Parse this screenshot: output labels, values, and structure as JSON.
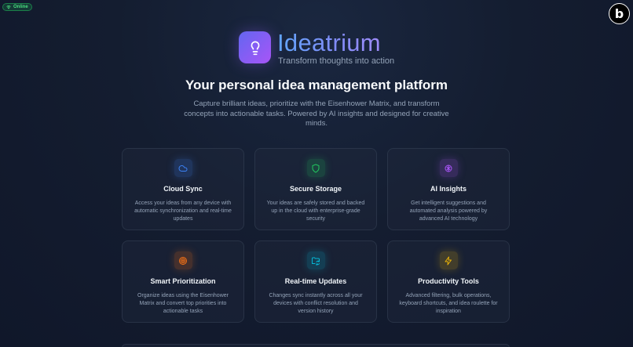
{
  "status": {
    "label": "Online",
    "icon": "wifi-icon",
    "color": "#4ade80"
  },
  "corner_badge": {
    "letter": "b"
  },
  "brand": {
    "title": "Ideatrium",
    "subtitle": "Transform thoughts into action",
    "icon": "lightbulb-icon"
  },
  "hero": {
    "headline": "Your personal idea management platform",
    "description": "Capture brilliant ideas, prioritize with the Eisenhower Matrix, and transform concepts into actionable tasks. Powered by AI insights and designed for creative minds."
  },
  "features": [
    {
      "icon": "cloud-icon",
      "accent": "#3b82f6",
      "title": "Cloud Sync",
      "description": "Access your ideas from any device with automatic synchronization and real-time updates"
    },
    {
      "icon": "shield-icon",
      "accent": "#22c55e",
      "title": "Secure Storage",
      "description": "Your ideas are safely stored and backed up in the cloud with enterprise-grade security"
    },
    {
      "icon": "brain-icon",
      "accent": "#a855f7",
      "title": "AI Insights",
      "description": "Get intelligent suggestions and automated analysis powered by advanced AI technology"
    },
    {
      "icon": "target-icon",
      "accent": "#f97316",
      "title": "Smart Prioritization",
      "description": "Organize ideas using the Eisenhower Matrix and convert top priorities into actionable tasks"
    },
    {
      "icon": "folder-sync-icon",
      "accent": "#06b6d4",
      "title": "Real-time Updates",
      "description": "Changes sync instantly across all your devices with conflict resolution and version history"
    },
    {
      "icon": "lightning-icon",
      "accent": "#eab308",
      "title": "Productivity Tools",
      "description": "Advanced filtering, bulk operations, keyboard shortcuts, and idea roulette for inspiration"
    }
  ]
}
